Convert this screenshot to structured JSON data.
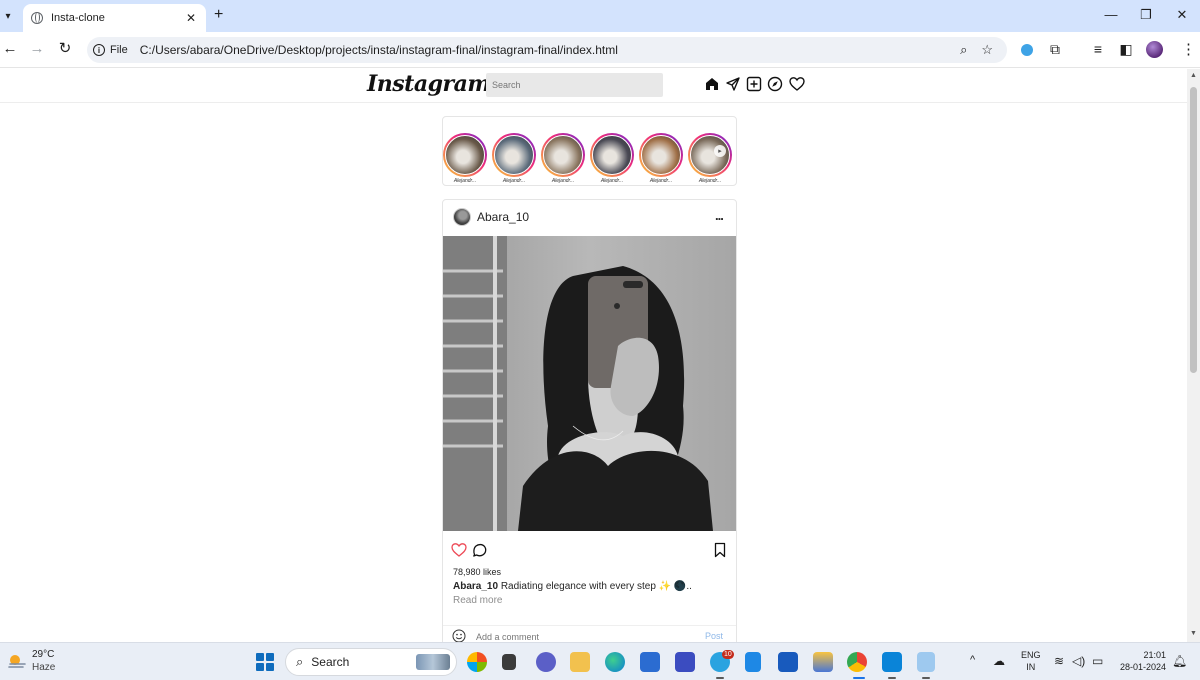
{
  "browser": {
    "tab_title": "Insta-clone",
    "scheme_label": "File",
    "url": "C:/Users/abara/OneDrive/Desktop/projects/insta/instagram-final/instagram-final/index.html"
  },
  "header": {
    "logo": "Instagram",
    "search_placeholder": "Search",
    "nav_icons": [
      "home-icon",
      "send-icon",
      "new-post-icon",
      "explore-icon",
      "heart-icon"
    ]
  },
  "stories": [
    {
      "name": "Alejandr...",
      "tone": "#6a5a4a"
    },
    {
      "name": "Alejandr...",
      "tone": "#5a6a7a"
    },
    {
      "name": "Alejandr...",
      "tone": "#8a7660"
    },
    {
      "name": "Alejandr...",
      "tone": "#4a4a55"
    },
    {
      "name": "Alejandr...",
      "tone": "#a07048"
    },
    {
      "name": "Alejandr...",
      "tone": "#7a6a5a"
    }
  ],
  "post": {
    "username": "Abara_10",
    "more_label": "...",
    "likes": "78,980 likes",
    "caption_user": "Abara_10",
    "caption_text": "Radiating elegance with every step ✨ 🌑..",
    "read_more": "Read more",
    "comment_placeholder": "Add a comment",
    "post_label": "Post"
  },
  "taskbar": {
    "temperature": "29°C",
    "weather": "Haze",
    "search_label": "Search",
    "notification_badge": "10",
    "lang_top": "ENG",
    "lang_bottom": "IN",
    "time": "21:01",
    "date": "28-01-2024"
  },
  "colors": {
    "tab_strip": "#d3e3fd",
    "like_icon": "#ed4956",
    "post_button": "#8fb8e8",
    "taskbar": "#e9eef6"
  }
}
